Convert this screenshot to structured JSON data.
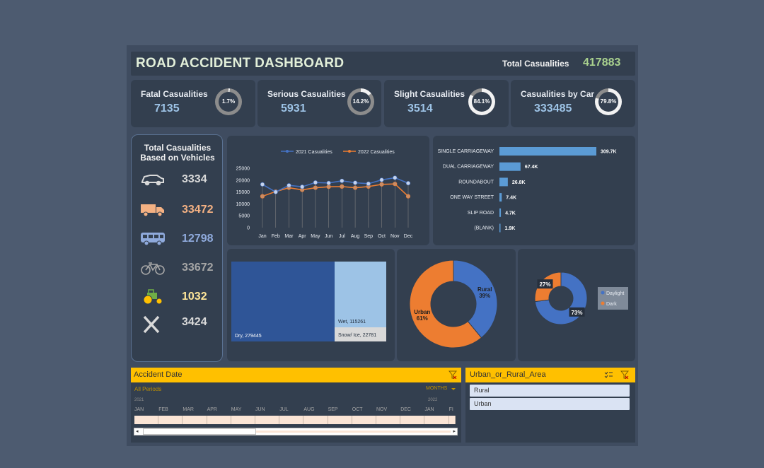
{
  "header": {
    "title": "ROAD ACCIDENT DASHBOARD",
    "total_label": "Total Casualities",
    "total_value": "417883"
  },
  "kpis": [
    {
      "label": "Fatal Casualities",
      "value": "7135",
      "pct": "1.7%",
      "fraction": 0.017
    },
    {
      "label": "Serious Casualities",
      "value": "5931",
      "pct": "14.2%",
      "fraction": 0.142
    },
    {
      "label": "Slight Casualities",
      "value": "3514",
      "pct": "84.1%",
      "fraction": 0.841
    },
    {
      "label": "Casualities by Car",
      "value": "333485",
      "pct": "79.8%",
      "fraction": 0.798
    }
  ],
  "vehicles": {
    "heading_line1": "Total Casualities",
    "heading_line2": "Based on Vehicles",
    "items": [
      {
        "icon": "car-icon",
        "value": "3334",
        "color": "#d9d9d9"
      },
      {
        "icon": "truck-icon",
        "value": "33472",
        "color": "#f4b183"
      },
      {
        "icon": "bus-icon",
        "value": "12798",
        "color": "#8faadc"
      },
      {
        "icon": "bicycle-icon",
        "value": "33672",
        "color": "#a6a6a6"
      },
      {
        "icon": "tractor-icon",
        "value": "1032",
        "color": "#ffe699"
      },
      {
        "icon": "close-icon",
        "value": "3424",
        "color": "#d9d9d9"
      }
    ]
  },
  "chart_data": [
    {
      "type": "line",
      "categories": [
        "Jan",
        "Feb",
        "Mar",
        "Apr",
        "May",
        "Jun",
        "Jul",
        "Aug",
        "Sep",
        "Oct",
        "Nov",
        "Dec"
      ],
      "series": [
        {
          "name": "2021 Casualities",
          "color": "#4472c4",
          "values": [
            18200,
            15000,
            17800,
            17200,
            19000,
            18800,
            19700,
            18900,
            18500,
            20100,
            21000,
            18700
          ]
        },
        {
          "name": "2022 Casualities",
          "color": "#ed7d31",
          "values": [
            13200,
            15200,
            16800,
            15900,
            16800,
            17200,
            17300,
            16800,
            17300,
            18200,
            18400,
            13200
          ]
        }
      ],
      "yticks": [
        "0",
        "5000",
        "10000",
        "15000",
        "20000",
        "25000"
      ],
      "ylim": [
        0,
        25000
      ],
      "legend": "top"
    },
    {
      "type": "bar",
      "orientation": "horizontal",
      "categories": [
        "SINGLE CARRIAGEWAY",
        "DUAL CARRIAGEWAY",
        "ROUNDABOUT",
        "ONE WAY STREET",
        "SLIP ROAD",
        "(BLANK)"
      ],
      "values": [
        309.7,
        67.4,
        26.8,
        7.4,
        4.7,
        1.9
      ],
      "labels": [
        "309.7K",
        "67.4K",
        "26.8K",
        "7.4K",
        "4.7K",
        "1.9K"
      ],
      "color": "#5b9bd5"
    },
    {
      "type": "treemap",
      "items": [
        {
          "label": "Dry, 279445",
          "value": 279445,
          "color": "#2f5597"
        },
        {
          "label": "Wet, 115261",
          "value": 115261,
          "color": "#9dc3e6"
        },
        {
          "label": "Snow/ Ice, 22781",
          "value": 22781,
          "color": "#d9d9d9"
        }
      ]
    },
    {
      "type": "pie",
      "variant": "donut",
      "slices": [
        {
          "label": "Rural",
          "pct": "39%",
          "value": 39,
          "color": "#4472c4"
        },
        {
          "label": "Urban",
          "pct": "61%",
          "value": 61,
          "color": "#ed7d31"
        }
      ]
    },
    {
      "type": "pie",
      "variant": "donut",
      "slices": [
        {
          "label": "Daylight",
          "pct": "73%",
          "value": 73,
          "color": "#4472c4"
        },
        {
          "label": "Dark",
          "pct": "27%",
          "value": 27,
          "color": "#ed7d31"
        }
      ],
      "legend": "right"
    }
  ],
  "date_slicer": {
    "title": "Accident Date",
    "period": "All Periods",
    "granularity": "MONTHS",
    "year1": "2021",
    "year2": "2022",
    "months": [
      "JAN",
      "FEB",
      "MAR",
      "APR",
      "MAY",
      "JUN",
      "JUL",
      "AUG",
      "SEP",
      "OCT",
      "NOV",
      "DEC",
      "JAN",
      "FI"
    ]
  },
  "area_slicer": {
    "title": "Urban_or_Rural_Area",
    "items": [
      "Rural",
      "Urban"
    ]
  }
}
